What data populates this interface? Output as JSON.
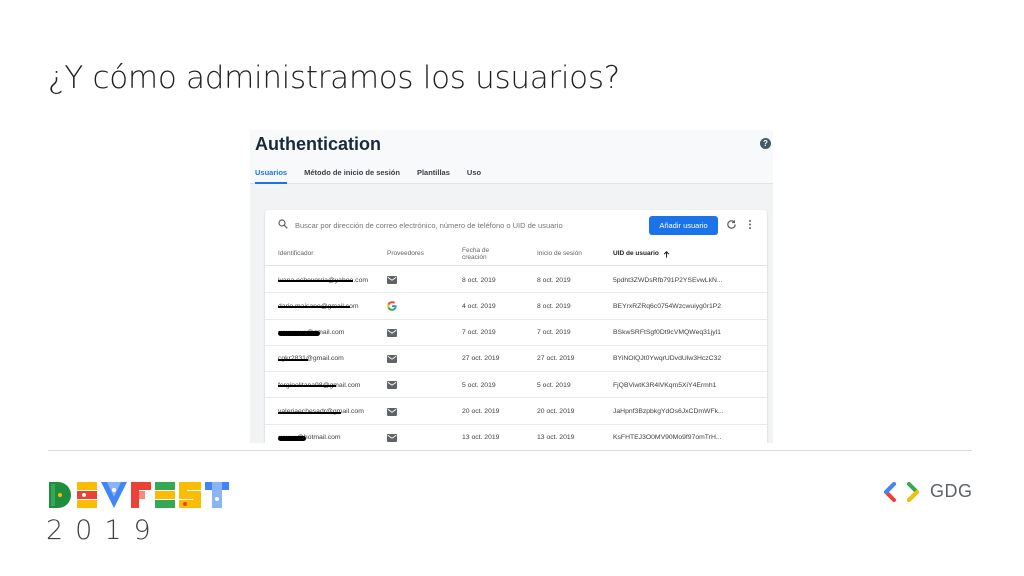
{
  "slide": {
    "title": "¿Y cómo administramos los usuarios?",
    "year": "2019",
    "gdg_label": "GDG"
  },
  "console": {
    "title": "Authentication",
    "help_icon": "help-circle-icon",
    "tabs": [
      {
        "label": "Usuarios",
        "active": true
      },
      {
        "label": "Método de inicio de sesión",
        "active": false
      },
      {
        "label": "Plantillas",
        "active": false
      },
      {
        "label": "Uso",
        "active": false
      }
    ],
    "search": {
      "placeholder": "Buscar por dirección de correo electrónico, número de teléfono o UID de usuario"
    },
    "add_user_label": "Añadir usuario",
    "columns": {
      "identifier": "Identificador",
      "providers": "Proveedores",
      "created": "Fecha de creación",
      "signin": "Inicio de sesión",
      "uid": "UID de usuario"
    },
    "sort_icon": "arrow-up-icon",
    "rows": [
      {
        "identifier": "ivana.echeverria@yahoo.com",
        "provider": "email",
        "created": "8 oct. 2019",
        "signin": "8 oct. 2019",
        "uid": "5pdht3ZWDsRfb791P2YSEvwLkN..."
      },
      {
        "identifier": "dario.maisano@gmail.com",
        "provider": "google",
        "created": "4 oct. 2019",
        "signin": "8 oct. 2019",
        "uid": "BEYrxRZRq6c0754Wzcwuiyg0r1P2"
      },
      {
        "identifier": "••••••••••••@gmail.com",
        "provider": "email",
        "created": "7 oct. 2019",
        "signin": "7 oct. 2019",
        "uid": "BSkwSRFtSgf0Dt9cVMQWeq31jyl1"
      },
      {
        "identifier": "cgkr2831@gmail.com",
        "provider": "email",
        "created": "27 oct. 2019",
        "signin": "27 oct. 2019",
        "uid": "BYiNOlQJt0YwqrUDvdUlw3HczC32"
      },
      {
        "identifier": "ferginolitana98@gmail.com",
        "provider": "email",
        "created": "5 oct. 2019",
        "signin": "5 oct. 2019",
        "uid": "FjQBViwtK3R4lVKqm5XiY4Ermh1"
      },
      {
        "identifier": "valeriaechesadr@gmail.com",
        "provider": "email",
        "created": "20 oct. 2019",
        "signin": "20 oct. 2019",
        "uid": "JaHpnf3BzpbkgYdOs6JxCDmWFk..."
      },
      {
        "identifier": "••••••••@hotmail.com",
        "provider": "email",
        "created": "13 oct. 2019",
        "signin": "13 oct. 2019",
        "uid": "KsFHTEJ3O0MV90Mo9f97omTrH..."
      }
    ]
  },
  "colors": {
    "accent": "#1a73e8",
    "google_red": "#ea4335",
    "google_blue": "#4285f4",
    "google_yellow": "#fbbc05",
    "google_green": "#34a853"
  }
}
